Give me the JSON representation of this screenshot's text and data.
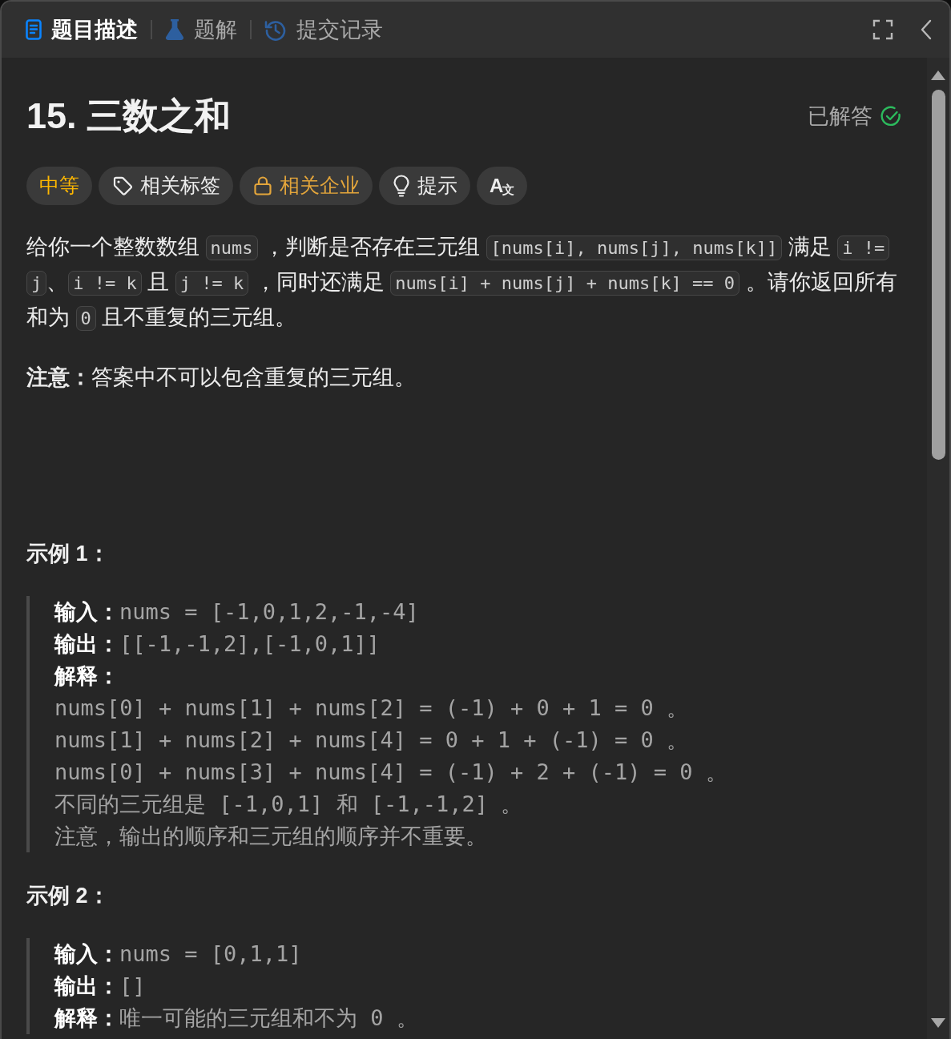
{
  "tabs": [
    {
      "kind": "description",
      "label": "题目描述",
      "selected": true
    },
    {
      "kind": "solutions",
      "label": "题解",
      "selected": false
    },
    {
      "kind": "submissions",
      "label": "提交记录",
      "selected": false
    }
  ],
  "problem": {
    "title": "15. 三数之和",
    "status": {
      "label": "已解答",
      "solved": true
    }
  },
  "tags": [
    {
      "kind": "difficulty",
      "label": "中等"
    },
    {
      "kind": "topics",
      "label": "相关标签"
    },
    {
      "kind": "companies",
      "label": "相关企业"
    },
    {
      "kind": "hint",
      "label": "提示"
    },
    {
      "kind": "translate",
      "label": "A文"
    }
  ],
  "description": [
    {
      "kind": "segments",
      "segments": [
        {
          "kind": "text",
          "text": "给你一个整数数组 "
        },
        {
          "kind": "code",
          "text": "nums"
        },
        {
          "kind": "text",
          "text": " ，判断是否存在三元组 "
        },
        {
          "kind": "code",
          "text": "[nums[i], nums[j], nums[k]]"
        },
        {
          "kind": "text",
          "text": " 满足 "
        },
        {
          "kind": "code",
          "text": "i != j"
        },
        {
          "kind": "text",
          "text": "、"
        },
        {
          "kind": "code",
          "text": "i != k"
        },
        {
          "kind": "text",
          "text": " 且 "
        },
        {
          "kind": "code",
          "text": "j != k"
        },
        {
          "kind": "text",
          "text": " ，同时还满足 "
        },
        {
          "kind": "code",
          "text": "nums[i] + nums[j] + nums[k] == 0"
        },
        {
          "kind": "text",
          "text": " 。请你返回所有和为 "
        },
        {
          "kind": "code",
          "text": "0"
        },
        {
          "kind": "text",
          "text": " 且不重复的三元组。"
        }
      ]
    },
    {
      "kind": "rich",
      "text": "**注意：**答案中不可以包含重复的三元组。"
    }
  ],
  "examples": [
    {
      "heading": "示例 1：",
      "lines": [
        {
          "label": "输入：",
          "value": "nums = [-1,0,1,2,-1,-4]"
        },
        {
          "label": "输出：",
          "value": "[[-1,-1,2],[-1,0,1]]"
        },
        {
          "label": "解释："
        },
        {
          "value": "nums[0] + nums[1] + nums[2] = (-1) + 0 + 1 = 0 。"
        },
        {
          "value": "nums[1] + nums[2] + nums[4] = 0 + 1 + (-1) = 0 。"
        },
        {
          "value": "nums[0] + nums[3] + nums[4] = (-1) + 2 + (-1) = 0 。"
        },
        {
          "value": "不同的三元组是 [-1,0,1] 和 [-1,-1,2] 。"
        },
        {
          "value": "注意，输出的顺序和三元组的顺序并不重要。"
        }
      ]
    },
    {
      "heading": "示例 2：",
      "lines": [
        {
          "label": "输入：",
          "value": "nums = [0,1,1]"
        },
        {
          "label": "输出：",
          "value": "[]"
        },
        {
          "label": "解释：",
          "value": "唯一可能的三元组和不为 0 。"
        }
      ]
    }
  ]
}
